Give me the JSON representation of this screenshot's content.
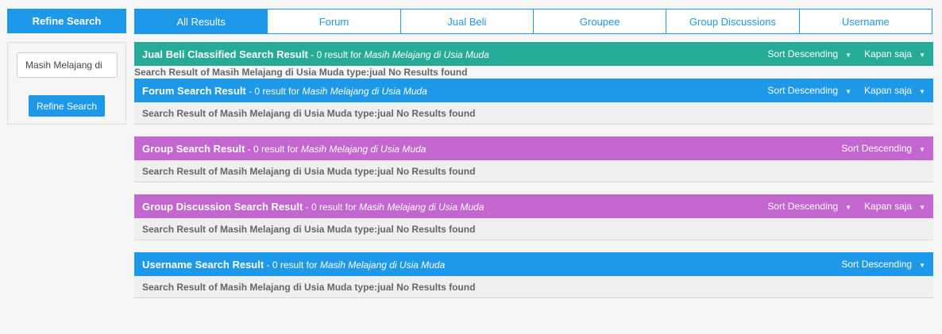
{
  "sidebar": {
    "header": "Refine Search",
    "search_value": "Masih Melajang di",
    "refine_button": "Refine Search"
  },
  "tabs": [
    {
      "label": "All Results",
      "active": true
    },
    {
      "label": "Forum",
      "active": false
    },
    {
      "label": "Jual Beli",
      "active": false
    },
    {
      "label": "Groupee",
      "active": false
    },
    {
      "label": "Group Discussions",
      "active": false
    },
    {
      "label": "Username",
      "active": false
    }
  ],
  "sections": {
    "jual_beli": {
      "title": "Jual Beli Classified Search Result",
      "count": " - 0 result for ",
      "query": "Masih Melajang di Usia Muda",
      "sort": "Sort Descending",
      "time": "Kapan saja",
      "note": "Search Result of Masih Melajang di Usia Muda type:jual No Results found"
    },
    "forum": {
      "title": "Forum Search Result",
      "count": " - 0 result for ",
      "query": "Masih Melajang di Usia Muda",
      "sort": "Sort Descending",
      "time": "Kapan saja",
      "body": "Search Result of Masih Melajang di Usia Muda type:jual No Results found"
    },
    "group": {
      "title": "Group Search Result",
      "count": " - 0 result for ",
      "query": "Masih Melajang di Usia Muda",
      "sort": "Sort Descending",
      "body": "Search Result of Masih Melajang di Usia Muda type:jual No Results found"
    },
    "group_discussion": {
      "title": "Group Discussion Search Result",
      "count": " - 0 result for ",
      "query": "Masih Melajang di Usia Muda",
      "sort": "Sort Descending",
      "time": "Kapan saja",
      "body": "Search Result of Masih Melajang di Usia Muda type:jual No Results found"
    },
    "username": {
      "title": "Username Search Result",
      "count": " - 0 result for ",
      "query": "Masih Melajang di Usia Muda",
      "sort": "Sort Descending",
      "body": "Search Result of Masih Melajang di Usia Muda type:jual No Results found"
    }
  },
  "colors": {
    "accent_blue": "#1e98e9",
    "teal": "#27ab99",
    "purple": "#c466cf"
  },
  "icons": {
    "dropdown": "caret-down-icon"
  }
}
